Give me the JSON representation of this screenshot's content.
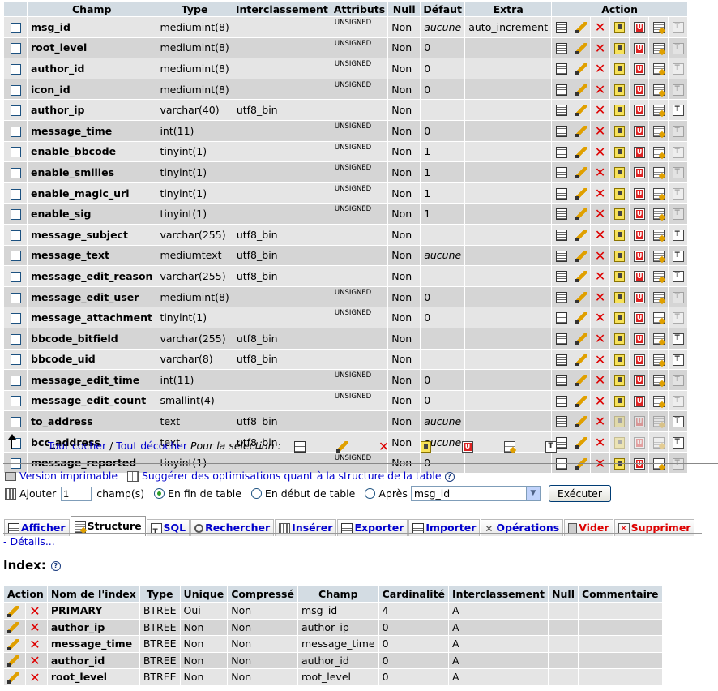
{
  "fields_table": {
    "headers": [
      "Champ",
      "Type",
      "Interclassement",
      "Attributs",
      "Null",
      "Défaut",
      "Extra",
      "Action"
    ],
    "rows": [
      {
        "name": "msg_id",
        "type": "mediumint(8)",
        "collation": "",
        "attributes": "UNSIGNED",
        "null": "Non",
        "default": "aucune",
        "default_italic": true,
        "extra": "auto_increment",
        "fulltext": false,
        "underline": true
      },
      {
        "name": "root_level",
        "type": "mediumint(8)",
        "collation": "",
        "attributes": "UNSIGNED",
        "null": "Non",
        "default": "0",
        "default_italic": false,
        "extra": "",
        "fulltext": false
      },
      {
        "name": "author_id",
        "type": "mediumint(8)",
        "collation": "",
        "attributes": "UNSIGNED",
        "null": "Non",
        "default": "0",
        "default_italic": false,
        "extra": "",
        "fulltext": false
      },
      {
        "name": "icon_id",
        "type": "mediumint(8)",
        "collation": "",
        "attributes": "UNSIGNED",
        "null": "Non",
        "default": "0",
        "default_italic": false,
        "extra": "",
        "fulltext": false
      },
      {
        "name": "author_ip",
        "type": "varchar(40)",
        "collation": "utf8_bin",
        "attributes": "",
        "null": "Non",
        "default": "",
        "default_italic": false,
        "extra": "",
        "fulltext": true
      },
      {
        "name": "message_time",
        "type": "int(11)",
        "collation": "",
        "attributes": "UNSIGNED",
        "null": "Non",
        "default": "0",
        "default_italic": false,
        "extra": "",
        "fulltext": false
      },
      {
        "name": "enable_bbcode",
        "type": "tinyint(1)",
        "collation": "",
        "attributes": "UNSIGNED",
        "null": "Non",
        "default": "1",
        "default_italic": false,
        "extra": "",
        "fulltext": false
      },
      {
        "name": "enable_smilies",
        "type": "tinyint(1)",
        "collation": "",
        "attributes": "UNSIGNED",
        "null": "Non",
        "default": "1",
        "default_italic": false,
        "extra": "",
        "fulltext": false
      },
      {
        "name": "enable_magic_url",
        "type": "tinyint(1)",
        "collation": "",
        "attributes": "UNSIGNED",
        "null": "Non",
        "default": "1",
        "default_italic": false,
        "extra": "",
        "fulltext": false
      },
      {
        "name": "enable_sig",
        "type": "tinyint(1)",
        "collation": "",
        "attributes": "UNSIGNED",
        "null": "Non",
        "default": "1",
        "default_italic": false,
        "extra": "",
        "fulltext": false
      },
      {
        "name": "message_subject",
        "type": "varchar(255)",
        "collation": "utf8_bin",
        "attributes": "",
        "null": "Non",
        "default": "",
        "default_italic": false,
        "extra": "",
        "fulltext": true
      },
      {
        "name": "message_text",
        "type": "mediumtext",
        "collation": "utf8_bin",
        "attributes": "",
        "null": "Non",
        "default": "aucune",
        "default_italic": true,
        "extra": "",
        "fulltext": true
      },
      {
        "name": "message_edit_reason",
        "type": "varchar(255)",
        "collation": "utf8_bin",
        "attributes": "",
        "null": "Non",
        "default": "",
        "default_italic": false,
        "extra": "",
        "fulltext": true
      },
      {
        "name": "message_edit_user",
        "type": "mediumint(8)",
        "collation": "",
        "attributes": "UNSIGNED",
        "null": "Non",
        "default": "0",
        "default_italic": false,
        "extra": "",
        "fulltext": false
      },
      {
        "name": "message_attachment",
        "type": "tinyint(1)",
        "collation": "",
        "attributes": "UNSIGNED",
        "null": "Non",
        "default": "0",
        "default_italic": false,
        "extra": "",
        "fulltext": false
      },
      {
        "name": "bbcode_bitfield",
        "type": "varchar(255)",
        "collation": "utf8_bin",
        "attributes": "",
        "null": "Non",
        "default": "",
        "default_italic": false,
        "extra": "",
        "fulltext": true
      },
      {
        "name": "bbcode_uid",
        "type": "varchar(8)",
        "collation": "utf8_bin",
        "attributes": "",
        "null": "Non",
        "default": "",
        "default_italic": false,
        "extra": "",
        "fulltext": true
      },
      {
        "name": "message_edit_time",
        "type": "int(11)",
        "collation": "",
        "attributes": "UNSIGNED",
        "null": "Non",
        "default": "0",
        "default_italic": false,
        "extra": "",
        "fulltext": false
      },
      {
        "name": "message_edit_count",
        "type": "smallint(4)",
        "collation": "",
        "attributes": "UNSIGNED",
        "null": "Non",
        "default": "0",
        "default_italic": false,
        "extra": "",
        "fulltext": false
      },
      {
        "name": "to_address",
        "type": "text",
        "collation": "utf8_bin",
        "attributes": "",
        "null": "Non",
        "default": "aucune",
        "default_italic": true,
        "extra": "",
        "fulltext": true,
        "text_type": true
      },
      {
        "name": "bcc_address",
        "type": "text",
        "collation": "utf8_bin",
        "attributes": "",
        "null": "Non",
        "default": "aucune",
        "default_italic": true,
        "extra": "",
        "fulltext": true,
        "text_type": true
      },
      {
        "name": "message_reported",
        "type": "tinyint(1)",
        "collation": "",
        "attributes": "UNSIGNED",
        "null": "Non",
        "default": "0",
        "default_italic": false,
        "extra": "",
        "fulltext": false
      }
    ]
  },
  "check_all": {
    "check_label": "Tout cocher",
    "separator": " / ",
    "uncheck_label": "Tout décocher",
    "selection_label": "Pour la sélection :"
  },
  "links": {
    "print_label": "Version imprimable",
    "suggest_label": "Suggérer des optimisations quant à la structure de la table",
    "help_glyph": "?"
  },
  "add_fields": {
    "label": "Ajouter",
    "count": "1",
    "unit_label": "champ(s)",
    "opt_end": "En fin de table",
    "opt_start": "En début de table",
    "opt_after": "Après",
    "after_select": "msg_id",
    "execute_label": "Exécuter"
  },
  "tabs": [
    {
      "label": "Afficher",
      "active": false,
      "danger": false
    },
    {
      "label": "Structure",
      "active": true,
      "danger": false
    },
    {
      "label": "SQL",
      "active": false,
      "danger": false
    },
    {
      "label": "Rechercher",
      "active": false,
      "danger": false
    },
    {
      "label": "Insérer",
      "active": false,
      "danger": false
    },
    {
      "label": "Exporter",
      "active": false,
      "danger": false
    },
    {
      "label": "Importer",
      "active": false,
      "danger": false
    },
    {
      "label": "Opérations",
      "active": false,
      "danger": false
    },
    {
      "label": "Vider",
      "active": false,
      "danger": true
    },
    {
      "label": "Supprimer",
      "active": false,
      "danger": true
    }
  ],
  "details_label": "- Détails...",
  "index_section": {
    "title": "Index:",
    "headers": [
      "Action",
      "Nom de l'index",
      "Type",
      "Unique",
      "Compressé",
      "Champ",
      "Cardinalité",
      "Interclassement",
      "Null",
      "Commentaire"
    ],
    "rows": [
      {
        "name": "PRIMARY",
        "type": "BTREE",
        "unique": "Oui",
        "packed": "Non",
        "field": "msg_id",
        "cardinality": "4",
        "collation": "A",
        "null": "",
        "comment": ""
      },
      {
        "name": "author_ip",
        "type": "BTREE",
        "unique": "Non",
        "packed": "Non",
        "field": "author_ip",
        "cardinality": "0",
        "collation": "A",
        "null": "",
        "comment": ""
      },
      {
        "name": "message_time",
        "type": "BTREE",
        "unique": "Non",
        "packed": "Non",
        "field": "message_time",
        "cardinality": "0",
        "collation": "A",
        "null": "",
        "comment": ""
      },
      {
        "name": "author_id",
        "type": "BTREE",
        "unique": "Non",
        "packed": "Non",
        "field": "author_id",
        "cardinality": "0",
        "collation": "A",
        "null": "",
        "comment": ""
      },
      {
        "name": "root_level",
        "type": "BTREE",
        "unique": "Non",
        "packed": "Non",
        "field": "root_level",
        "cardinality": "0",
        "collation": "A",
        "null": "",
        "comment": ""
      }
    ]
  },
  "icons": [
    "browse-icon",
    "edit-icon",
    "drop-icon",
    "primary-icon",
    "unique-icon",
    "index-icon",
    "fulltext-icon"
  ],
  "colors": {
    "header_bg": "#d3dce3",
    "row_odd": "#e5e5e5",
    "row_even": "#d5d5d5",
    "link": "#0000cc",
    "danger": "#dd0000"
  }
}
